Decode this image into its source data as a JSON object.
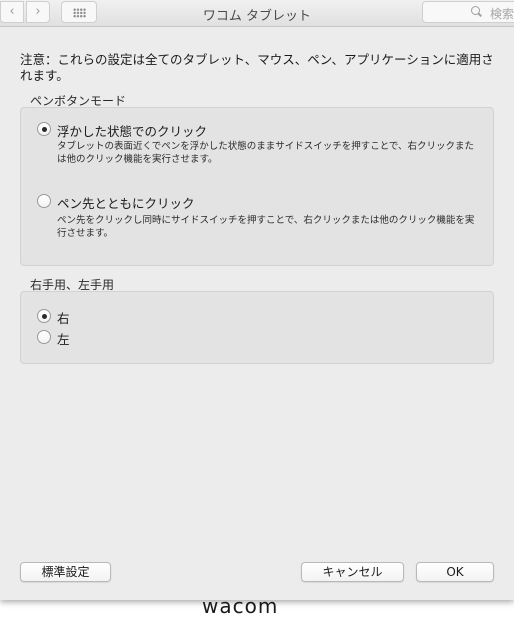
{
  "toolbar": {
    "back_icon": "‹",
    "forward_icon": "›",
    "title": "ワコム タブレット",
    "search_placeholder": "検索"
  },
  "notice": "注意：これらの設定は全てのタブレット、マウス、ペン、アプリケーションに適用されます。",
  "pen_button_mode": {
    "title": "ペンボタンモード",
    "options": [
      {
        "label": "浮かした状態でのクリック",
        "description": "タブレットの表面近くでペンを浮かした状態のままサイドスイッチを押すことで、右クリックまたは他のクリック機能を実行させます。",
        "selected": true
      },
      {
        "label": "ペン先とともにクリック",
        "description": "ペン先をクリックし同時にサイドスイッチを押すことで、右クリックまたは他のクリック機能を実行させます。",
        "selected": false
      }
    ]
  },
  "handedness": {
    "title": "右手用、左手用",
    "options": [
      {
        "label": "右",
        "selected": true
      },
      {
        "label": "左",
        "selected": false
      }
    ]
  },
  "buttons": {
    "default": "標準設定",
    "cancel": "キャンセル",
    "ok": "OK"
  },
  "logo": "wacom"
}
